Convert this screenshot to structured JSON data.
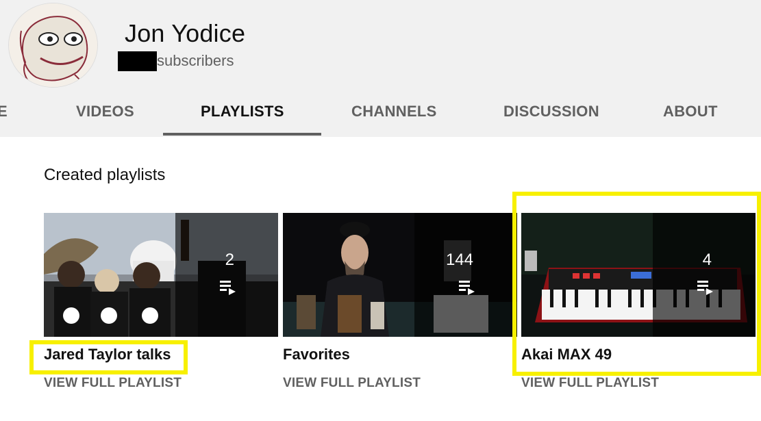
{
  "channel": {
    "name": "Jon Yodice",
    "subscribers_label": "subscribers"
  },
  "tabs": [
    {
      "label": "E"
    },
    {
      "label": "VIDEOS"
    },
    {
      "label": "PLAYLISTS",
      "active": true
    },
    {
      "label": "CHANNELS"
    },
    {
      "label": "DISCUSSION"
    },
    {
      "label": "ABOUT"
    }
  ],
  "section": {
    "title": "Created playlists"
  },
  "playlists": [
    {
      "title": "Jared Taylor talks",
      "count": "2",
      "link": "VIEW FULL PLAYLIST"
    },
    {
      "title": "Favorites",
      "count": "144",
      "link": "VIEW FULL PLAYLIST"
    },
    {
      "title": "Akai MAX 49",
      "count": "4",
      "link": "VIEW FULL PLAYLIST"
    }
  ],
  "colors": {
    "header_bg": "#f1f1f1",
    "highlight": "#f7f000",
    "tab_inactive": "#606060",
    "tab_active": "#111111"
  }
}
